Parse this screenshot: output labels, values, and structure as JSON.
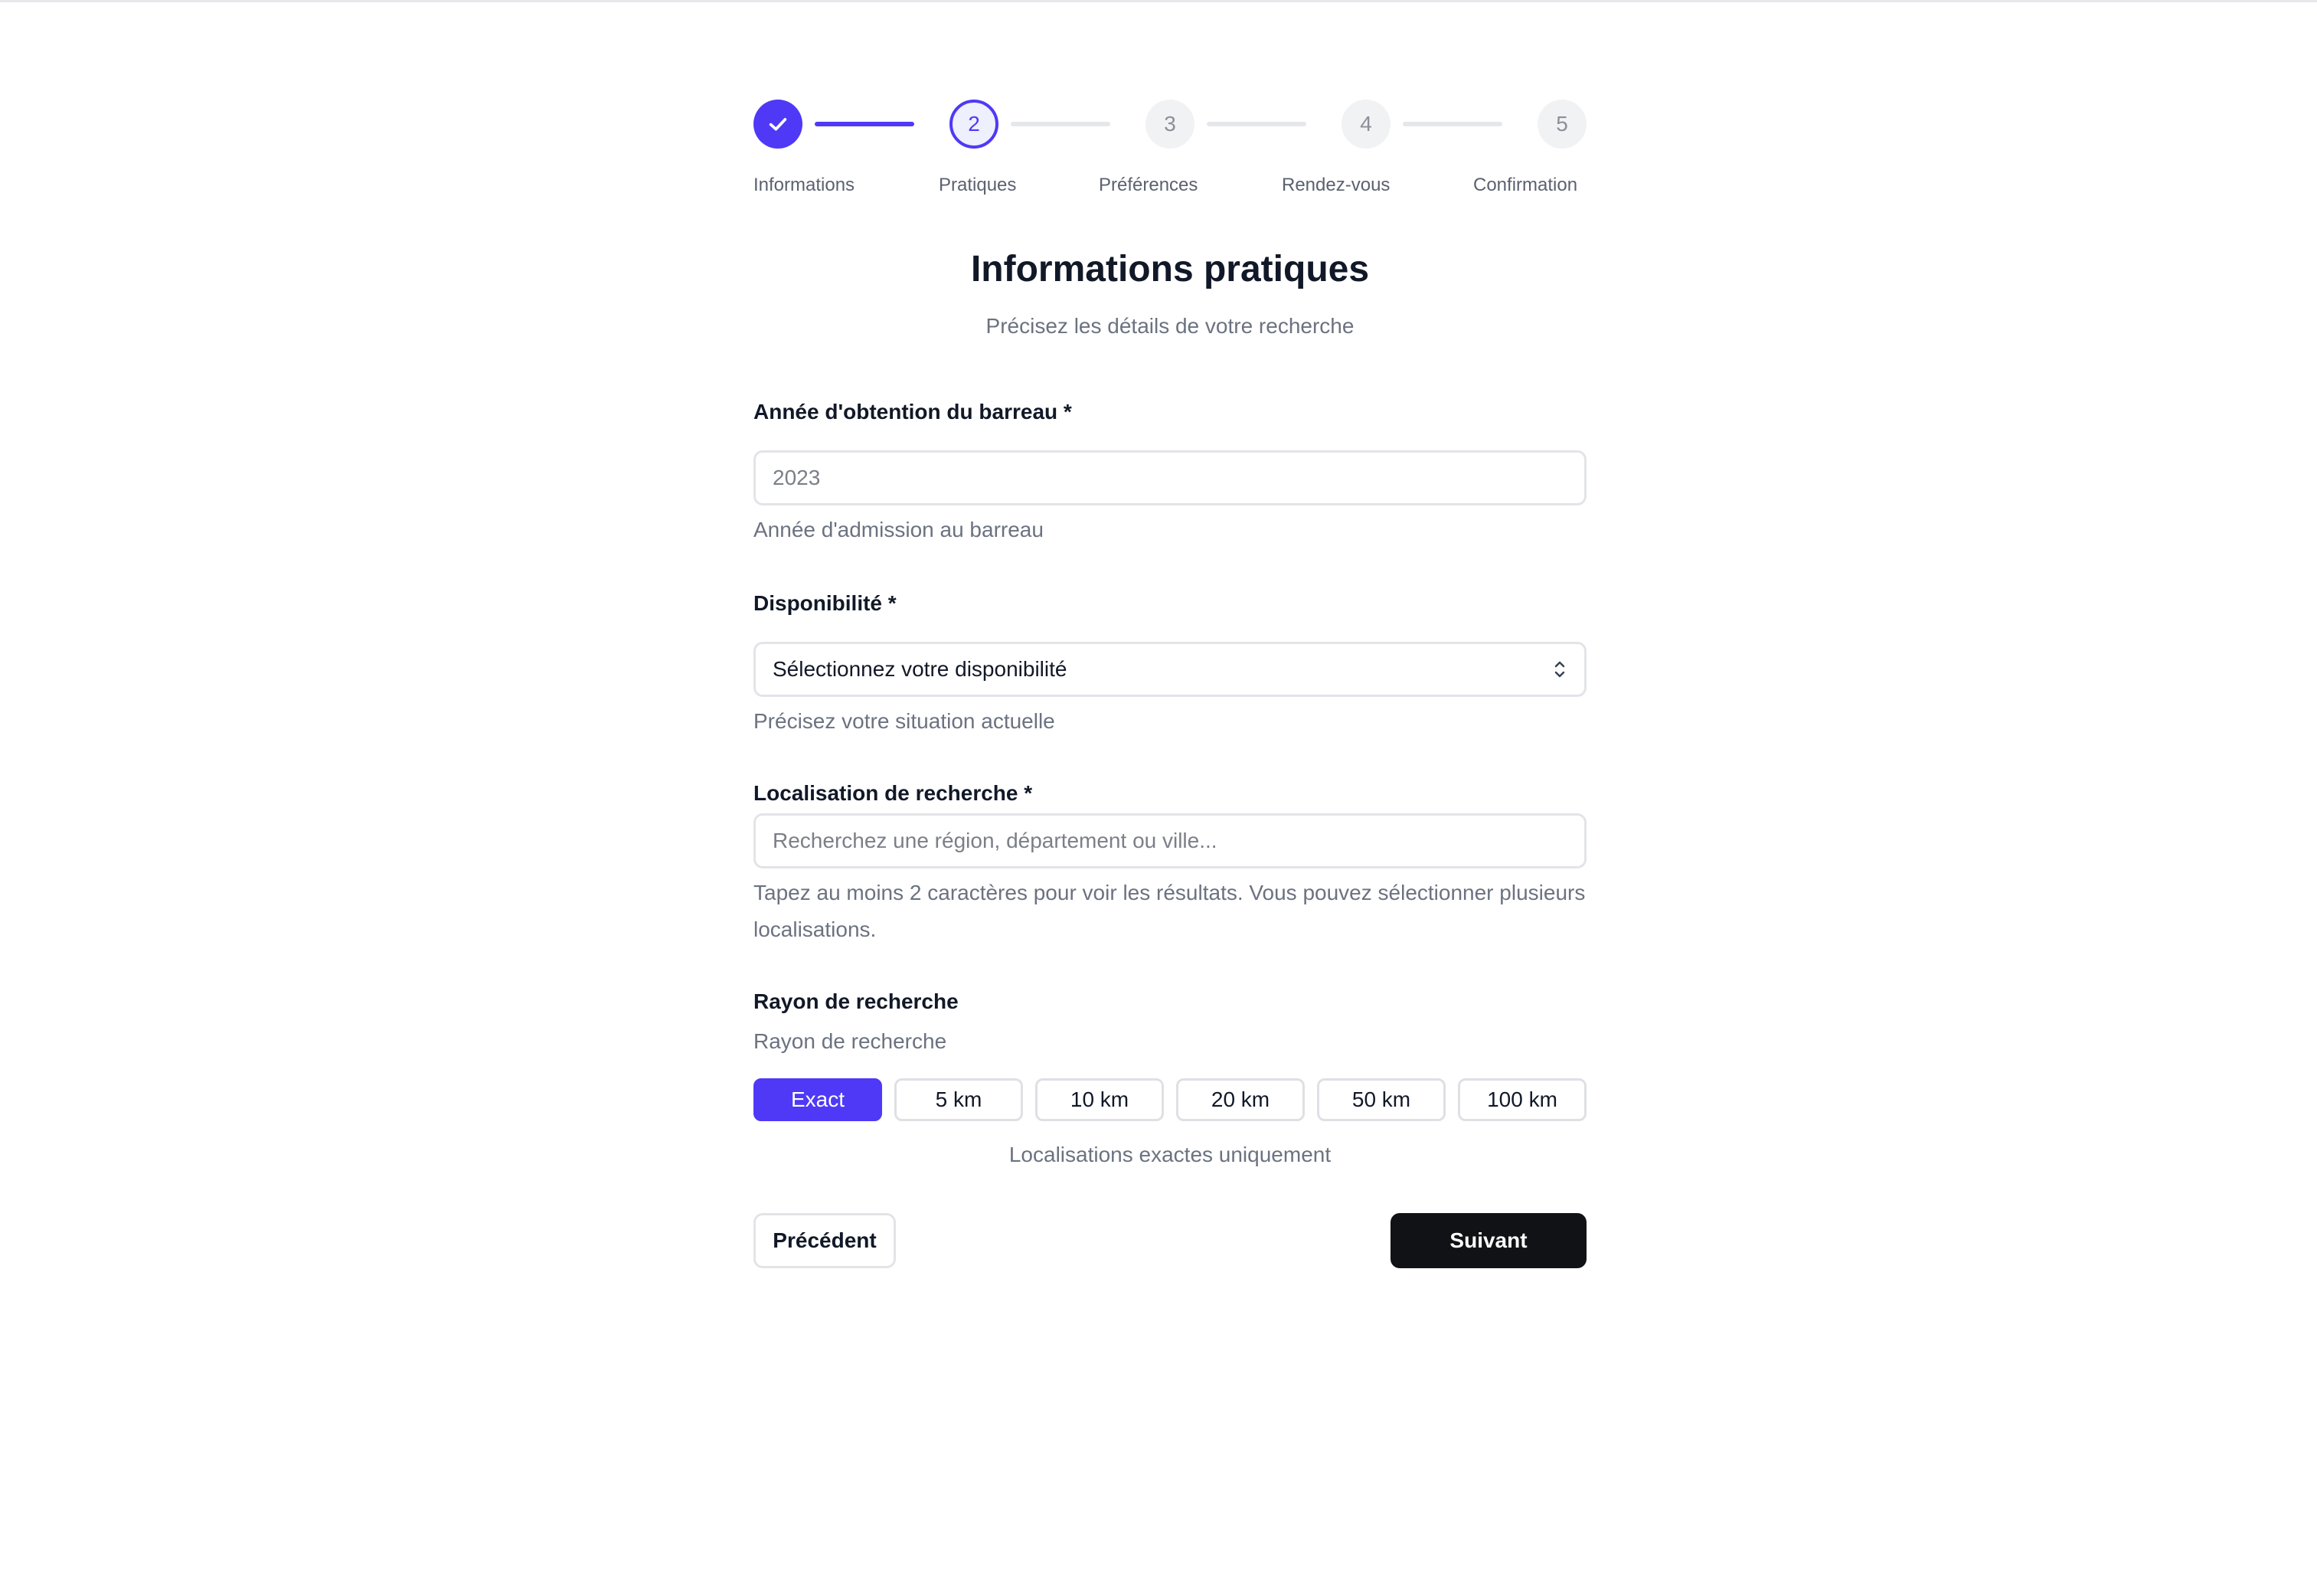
{
  "stepper": {
    "steps": [
      {
        "number": "",
        "label": "Informations",
        "state": "done"
      },
      {
        "number": "2",
        "label": "Pratiques",
        "state": "current"
      },
      {
        "number": "3",
        "label": "Préférences",
        "state": "todo"
      },
      {
        "number": "4",
        "label": "Rendez-vous",
        "state": "todo"
      },
      {
        "number": "5",
        "label": "Confirmation",
        "state": "todo"
      }
    ]
  },
  "header": {
    "title": "Informations pratiques",
    "subtitle": "Précisez les détails de votre recherche"
  },
  "form": {
    "bar_year": {
      "label": "Année d'obtention du barreau *",
      "placeholder": "2023",
      "value": "",
      "help": "Année d'admission au barreau"
    },
    "availability": {
      "label": "Disponibilité *",
      "selected": "Sélectionnez votre disponibilité",
      "help": "Précisez votre situation actuelle"
    },
    "location": {
      "label": "Localisation de recherche *",
      "placeholder": "Recherchez une région, département ou ville...",
      "value": "",
      "help": "Tapez au moins 2 caractères pour voir les résultats. Vous pouvez sélectionner plusieurs localisations."
    },
    "radius": {
      "label": "Rayon de recherche",
      "sublabel": "Rayon de recherche",
      "options": [
        "Exact",
        "5 km",
        "10 km",
        "20 km",
        "50 km",
        "100 km"
      ],
      "selected_index": 0,
      "caption": "Localisations exactes uniquement"
    }
  },
  "navigation": {
    "prev_label": "Précédent",
    "next_label": "Suivant"
  },
  "colors": {
    "accent": "#4f39f6",
    "primary_button": "#111216"
  },
  "icons": {
    "done_step": "check-icon",
    "select": "chevron-up-down-icon"
  }
}
